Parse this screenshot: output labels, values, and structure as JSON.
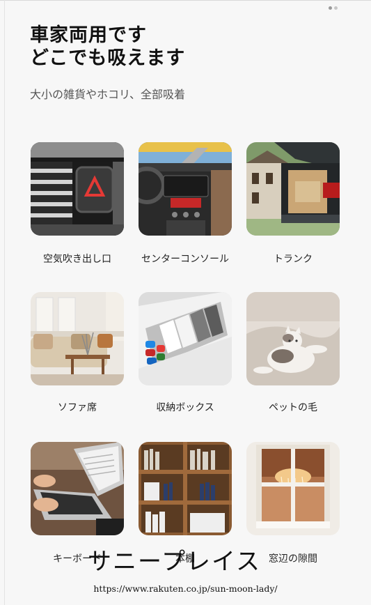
{
  "header": {
    "title_line1": "車家両用です",
    "title_line2": "どこでも吸えます",
    "subtitle": "大小の雑貨やホコリ、全部吸着"
  },
  "grid": {
    "items": [
      {
        "label": "空気吹き出し口",
        "icon": "car-air-vent-photo"
      },
      {
        "label": "センターコンソール",
        "icon": "center-console-photo"
      },
      {
        "label": "トランク",
        "icon": "car-trunk-photo"
      },
      {
        "label": "ソファ席",
        "icon": "sofa-photo"
      },
      {
        "label": "収納ボックス",
        "icon": "storage-box-photo"
      },
      {
        "label": "ペットの毛",
        "icon": "cat-photo"
      },
      {
        "label": "キーボード",
        "icon": "keyboard-photo"
      },
      {
        "label": "本棚",
        "icon": "bookshelf-photo"
      },
      {
        "label": "窓辺の隙間",
        "icon": "window-photo"
      }
    ]
  },
  "watermark": {
    "text": "サニープレイス",
    "url": "https://www.rakuten.co.jp/sun-moon-lady/"
  }
}
